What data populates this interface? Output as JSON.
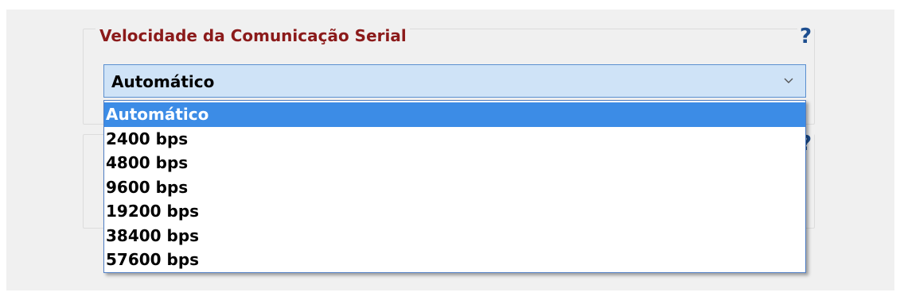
{
  "section1": {
    "legend": "Velocidade da Comunicação Serial",
    "help": "?"
  },
  "section2": {
    "help": "?"
  },
  "select": {
    "value": "Automático",
    "icon": "chevron-down-icon"
  },
  "dropdown": {
    "options": [
      "Automático",
      "2400 bps",
      "4800 bps",
      "9600 bps",
      "19200 bps",
      "38400 bps",
      "57600 bps"
    ],
    "selected_index": 0
  },
  "colors": {
    "legend": "#8b1a1a",
    "help": "#1d4e8f",
    "select_bg": "#cfe3f7",
    "highlight": "#3c8ce6",
    "panel_bg": "#f0f0f0"
  }
}
